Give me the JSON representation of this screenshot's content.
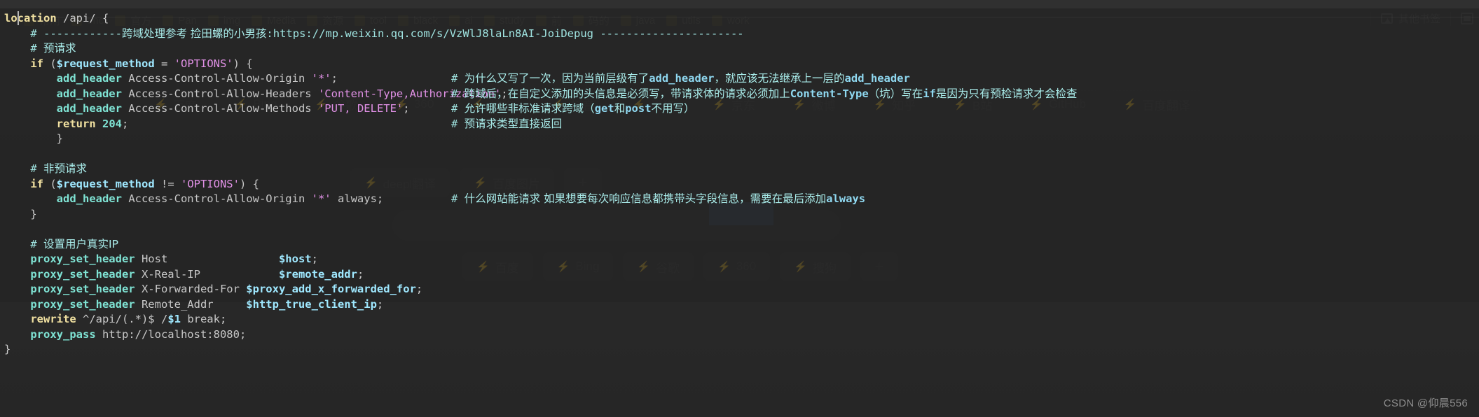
{
  "window": {
    "watermark": "CSDN @仰晨556"
  },
  "browser": {
    "bookmark_bar": {
      "items": [
        {
          "label": "常用"
        },
        {
          "label": "tmc"
        },
        {
          "label": "官方"
        },
        {
          "label": "Pan"
        },
        {
          "label": "img"
        },
        {
          "label": "Media"
        },
        {
          "label": "资源"
        },
        {
          "label": "tool"
        },
        {
          "label": "black"
        },
        {
          "label": "ai"
        },
        {
          "label": "study"
        },
        {
          "label": "前"
        },
        {
          "label": "码的"
        },
        {
          "label": "java"
        },
        {
          "label": "utils"
        },
        {
          "label": "work"
        }
      ],
      "second_row": [
        {
          "label": "邮箱"
        },
        {
          "label": "网"
        },
        {
          "label": "B站"
        },
        {
          "label": "antd"
        },
        {
          "label": "139邮箱"
        },
        {
          "label": "+"
        }
      ],
      "other_bookmarks_label": "其他书签",
      "other_bookmarks_icon": "bookmark-folder-icon",
      "reading_list_icon": "reading-list-icon"
    },
    "shortcut_rows": [
      {
        "chips": [
          {
            "icon": "bolt-icon",
            "label": "百度"
          },
          {
            "icon": "bolt-icon",
            "label": "Bing"
          },
          {
            "icon": "bolt-icon",
            "label": "谷歌"
          },
          {
            "icon": "bolt-icon",
            "label": "360"
          },
          {
            "icon": "bolt-icon",
            "label": "搜狗"
          },
          {
            "icon": "bolt-icon",
            "label": "抖音"
          },
          {
            "icon": "bolt-icon",
            "label": "天猫"
          },
          {
            "icon": "bolt-icon",
            "label": "京东"
          },
          {
            "icon": "bolt-icon",
            "label": "微博"
          },
          {
            "icon": "bolt-icon",
            "label": "知乎"
          },
          {
            "icon": "bolt-icon",
            "label": "B站"
          },
          {
            "icon": "bolt-icon",
            "label": "GitHub"
          },
          {
            "icon": "bolt-icon",
            "label": "百度翻译"
          }
        ]
      },
      {
        "chips": [
          {
            "icon": "bolt-icon",
            "label": "deepl翻译"
          },
          {
            "icon": "bolt-icon",
            "label": "百度图片"
          },
          {
            "icon": "plus-icon",
            "label": "+"
          }
        ]
      },
      {
        "chips": [
          {
            "icon": "bolt-icon",
            "label": "百度"
          },
          {
            "icon": "bolt-icon",
            "label": "Bing"
          },
          {
            "icon": "bolt-icon",
            "label": "谷歌"
          },
          {
            "icon": "bolt-icon",
            "label": "360"
          },
          {
            "icon": "bolt-icon",
            "label": "搜狗"
          },
          {
            "icon": "plus-icon",
            "label": "+"
          }
        ]
      }
    ]
  },
  "editor": {
    "language": "nginx",
    "theme_background": "#242424",
    "colors": {
      "keyword": "#f0e0a0",
      "directive": "#7fe3d4",
      "string": "#e191e6",
      "variable": "#9fe8ff",
      "comment": "#9fe3e0",
      "text": "#c8c8c8"
    },
    "lines": [
      {
        "id": 1,
        "indent": 0,
        "code": "location /api/ {",
        "parts": [
          {
            "t": "kw",
            "s": "location"
          },
          {
            "t": "plain",
            "s": " /api/ "
          },
          {
            "t": "punc",
            "s": "{"
          }
        ],
        "comment": ""
      },
      {
        "id": 2,
        "indent": 1,
        "parts": [
          {
            "t": "cmt",
            "s": "# ------------"
          },
          {
            "t": "cmtcn",
            "s": "跨域处理参考 捡田螺的小男孩"
          },
          {
            "t": "cmt",
            "s": ":https://mp.weixin.qq.com/s/VzWlJ8laLn8AI-JoiDepug ----------------------"
          }
        ],
        "comment": ""
      },
      {
        "id": 3,
        "indent": 1,
        "parts": [
          {
            "t": "cmt",
            "s": "# "
          },
          {
            "t": "cmtcn",
            "s": "预请求"
          }
        ],
        "comment": ""
      },
      {
        "id": 4,
        "indent": 1,
        "parts": [
          {
            "t": "kw",
            "s": "if"
          },
          {
            "t": "plain",
            "s": " ("
          },
          {
            "t": "var",
            "s": "$request_method"
          },
          {
            "t": "plain",
            "s": " = "
          },
          {
            "t": "str",
            "s": "'OPTIONS'"
          },
          {
            "t": "plain",
            "s": ") {"
          }
        ],
        "comment": ""
      },
      {
        "id": 5,
        "indent": 2,
        "parts": [
          {
            "t": "dir",
            "s": "add_header"
          },
          {
            "t": "plain",
            "s": " Access-Control-Allow-Origin "
          },
          {
            "t": "str",
            "s": "'*'"
          },
          {
            "t": "plain",
            "s": ";"
          }
        ],
        "comment_col": 644,
        "comment_parts": [
          {
            "t": "cmt",
            "s": "# "
          },
          {
            "t": "cmtcn",
            "s": "为什么又写了一次，因为当前层级有了"
          },
          {
            "t": "cmtcode",
            "s": "add_header"
          },
          {
            "t": "cmtcn",
            "s": "，就应该无法继承上一层的"
          },
          {
            "t": "cmtcode",
            "s": "add_header"
          }
        ]
      },
      {
        "id": 6,
        "indent": 2,
        "parts": [
          {
            "t": "dir",
            "s": "add_header"
          },
          {
            "t": "plain",
            "s": " Access-Control-Allow-Headers "
          },
          {
            "t": "str",
            "s": "'Content-Type,Authorization'"
          },
          {
            "t": "plain",
            "s": ";"
          }
        ],
        "comment_col": 644,
        "comment_parts": [
          {
            "t": "cmt",
            "s": "# "
          },
          {
            "t": "cmtcn",
            "s": "跨域后，在自定义添加的头信息是必须写，带请求体的请求必须加上"
          },
          {
            "t": "cmtcode",
            "s": "Content-Type"
          },
          {
            "t": "cmtcn",
            "s": "（坑）写在"
          },
          {
            "t": "cmtcode",
            "s": "if"
          },
          {
            "t": "cmtcn",
            "s": "是因为只有预检请求才会检查"
          }
        ]
      },
      {
        "id": 7,
        "indent": 2,
        "parts": [
          {
            "t": "dir",
            "s": "add_header"
          },
          {
            "t": "plain",
            "s": " Access-Control-Allow-Methods "
          },
          {
            "t": "str",
            "s": "'PUT, DELETE'"
          },
          {
            "t": "plain",
            "s": ";"
          }
        ],
        "comment_col": 644,
        "comment_parts": [
          {
            "t": "cmt",
            "s": "# "
          },
          {
            "t": "cmtcn",
            "s": "允许哪些非标准请求跨域（"
          },
          {
            "t": "cmtcode",
            "s": "get"
          },
          {
            "t": "cmtcn",
            "s": "和"
          },
          {
            "t": "cmtcode",
            "s": "post"
          },
          {
            "t": "cmtcn",
            "s": "不用写）"
          }
        ]
      },
      {
        "id": 8,
        "indent": 2,
        "parts": [
          {
            "t": "kw",
            "s": "return"
          },
          {
            "t": "plain",
            "s": " "
          },
          {
            "t": "num",
            "s": "204"
          },
          {
            "t": "plain",
            "s": ";"
          }
        ],
        "comment_col": 644,
        "comment_parts": [
          {
            "t": "cmt",
            "s": "# "
          },
          {
            "t": "cmtcn",
            "s": "预请求类型直接返回"
          }
        ]
      },
      {
        "id": 9,
        "indent": 2,
        "parts": [
          {
            "t": "punc",
            "s": "}"
          }
        ],
        "comment": ""
      },
      {
        "id": 10,
        "indent": 0,
        "parts": [],
        "comment": ""
      },
      {
        "id": 11,
        "indent": 1,
        "parts": [
          {
            "t": "cmt",
            "s": "# "
          },
          {
            "t": "cmtcn",
            "s": "非预请求"
          }
        ],
        "comment": ""
      },
      {
        "id": 12,
        "indent": 1,
        "parts": [
          {
            "t": "kw",
            "s": "if"
          },
          {
            "t": "plain",
            "s": " ("
          },
          {
            "t": "var",
            "s": "$request_method"
          },
          {
            "t": "plain",
            "s": " != "
          },
          {
            "t": "str",
            "s": "'OPTIONS'"
          },
          {
            "t": "plain",
            "s": ") {"
          }
        ],
        "comment": ""
      },
      {
        "id": 13,
        "indent": 2,
        "parts": [
          {
            "t": "dir",
            "s": "add_header"
          },
          {
            "t": "plain",
            "s": " Access-Control-Allow-Origin "
          },
          {
            "t": "str",
            "s": "'*'"
          },
          {
            "t": "plain",
            "s": " always;"
          }
        ],
        "comment_col": 644,
        "comment_parts": [
          {
            "t": "cmt",
            "s": "# "
          },
          {
            "t": "cmtcn",
            "s": "什么网站能请求 如果想要每次响应信息都携带头字段信息，需要在最后添加"
          },
          {
            "t": "cmtcode",
            "s": "always"
          }
        ]
      },
      {
        "id": 14,
        "indent": 1,
        "parts": [
          {
            "t": "punc",
            "s": "}"
          }
        ],
        "comment": ""
      },
      {
        "id": 15,
        "indent": 0,
        "parts": [],
        "comment": ""
      },
      {
        "id": 16,
        "indent": 1,
        "parts": [
          {
            "t": "cmt",
            "s": "# "
          },
          {
            "t": "cmtcn",
            "s": "设置用户真实IP"
          }
        ],
        "comment": ""
      },
      {
        "id": 17,
        "indent": 1,
        "parts": [
          {
            "t": "dir",
            "s": "proxy_set_header"
          },
          {
            "t": "plain",
            "s": " Host                 "
          },
          {
            "t": "var",
            "s": "$host"
          },
          {
            "t": "plain",
            "s": ";"
          }
        ],
        "comment": ""
      },
      {
        "id": 18,
        "indent": 1,
        "parts": [
          {
            "t": "dir",
            "s": "proxy_set_header"
          },
          {
            "t": "plain",
            "s": " X-Real-IP            "
          },
          {
            "t": "var",
            "s": "$remote_addr"
          },
          {
            "t": "plain",
            "s": ";"
          }
        ],
        "comment": ""
      },
      {
        "id": 19,
        "indent": 1,
        "parts": [
          {
            "t": "dir",
            "s": "proxy_set_header"
          },
          {
            "t": "plain",
            "s": " X-Forwarded-For "
          },
          {
            "t": "var",
            "s": "$proxy_add_x_forwarded_for"
          },
          {
            "t": "plain",
            "s": ";"
          }
        ],
        "comment": ""
      },
      {
        "id": 20,
        "indent": 1,
        "parts": [
          {
            "t": "dir",
            "s": "proxy_set_header"
          },
          {
            "t": "plain",
            "s": " Remote_Addr     "
          },
          {
            "t": "var",
            "s": "$http_true_client_ip"
          },
          {
            "t": "plain",
            "s": ";"
          }
        ],
        "comment": ""
      },
      {
        "id": 21,
        "indent": 1,
        "parts": [
          {
            "t": "kw",
            "s": "rewrite"
          },
          {
            "t": "plain",
            "s": " ^/api/(.*)$ /"
          },
          {
            "t": "var",
            "s": "$1"
          },
          {
            "t": "plain",
            "s": " break;"
          }
        ],
        "comment": ""
      },
      {
        "id": 22,
        "indent": 1,
        "parts": [
          {
            "t": "dir",
            "s": "proxy_pass"
          },
          {
            "t": "plain",
            "s": " http://localhost:8080;"
          }
        ],
        "comment": ""
      },
      {
        "id": 23,
        "indent": 0,
        "parts": [
          {
            "t": "punc",
            "s": "}"
          }
        ],
        "comment": ""
      }
    ]
  }
}
